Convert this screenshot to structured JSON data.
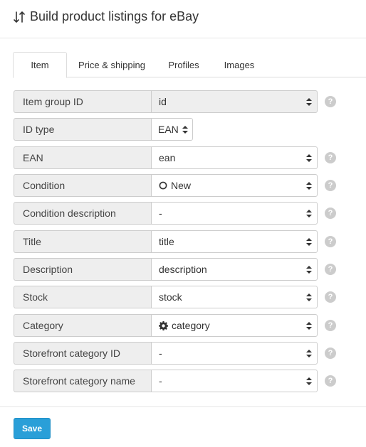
{
  "header": {
    "title": "Build product listings for eBay",
    "icon": "sort-arrows-icon"
  },
  "tabs": [
    {
      "label": "Item",
      "active": true
    },
    {
      "label": "Price & shipping",
      "active": false
    },
    {
      "label": "Profiles",
      "active": false
    },
    {
      "label": "Images",
      "active": false
    }
  ],
  "fields": [
    {
      "label": "Item group ID",
      "value": "id",
      "disabled": true,
      "help": true
    },
    {
      "label": "ID type",
      "value": "EAN",
      "small": true,
      "help": false
    },
    {
      "label": "EAN",
      "value": "ean",
      "help": true
    },
    {
      "label": "Condition",
      "value": "New",
      "value_icon": "circle-outline-icon",
      "help": true
    },
    {
      "label": "Condition description",
      "value": "-",
      "help": true
    },
    {
      "label": "Title",
      "value": "title",
      "help": true
    },
    {
      "label": "Description",
      "value": "description",
      "help": true
    },
    {
      "label": "Stock",
      "value": "stock",
      "help": true
    },
    {
      "label": "Category",
      "value": "category",
      "value_icon": "gear-icon",
      "help": true
    },
    {
      "label": "Storefront category ID",
      "value": "-",
      "help": true
    },
    {
      "label": "Storefront category name",
      "value": "-",
      "help": true
    }
  ],
  "footer": {
    "save_label": "Save"
  },
  "colors": {
    "accent": "#2a9fd8",
    "label_bg": "#eeeeee",
    "border": "#cccccc",
    "help_icon": "#cccccc"
  }
}
